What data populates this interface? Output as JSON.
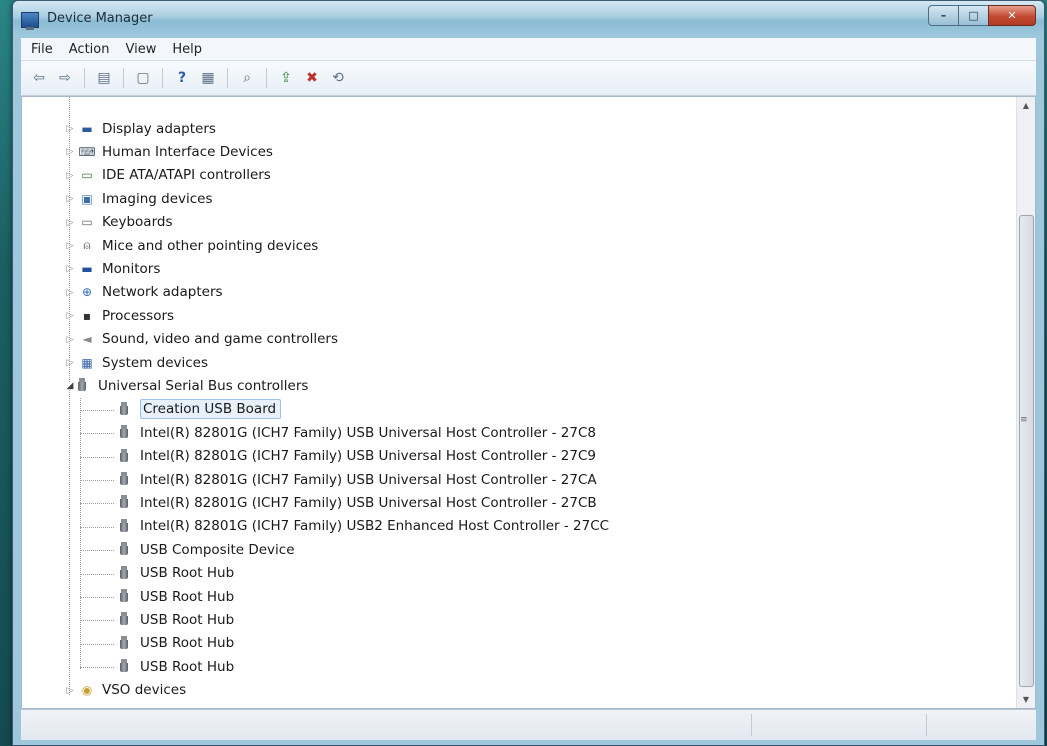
{
  "window": {
    "title": "Device Manager",
    "caption_buttons": {
      "minimize": "–",
      "maximize": "□",
      "close": "✕"
    }
  },
  "menu": [
    "File",
    "Action",
    "View",
    "Help"
  ],
  "toolbar": {
    "buttons": [
      "back-icon",
      "forward-icon",
      "console-tree-icon",
      "properties-icon",
      "help-icon",
      "show-hide-icon",
      "scan-changes-icon",
      "update-driver-icon",
      "uninstall-icon",
      "disable-icon"
    ]
  },
  "tree": {
    "categories_top": [
      {
        "label": "Display adapters",
        "icon": "display-adapter-icon"
      },
      {
        "label": "Human Interface Devices",
        "icon": "hid-icon"
      },
      {
        "label": "IDE ATA/ATAPI controllers",
        "icon": "ide-icon"
      },
      {
        "label": "Imaging devices",
        "icon": "imaging-icon"
      },
      {
        "label": "Keyboards",
        "icon": "keyboard-icon"
      },
      {
        "label": "Mice and other pointing devices",
        "icon": "mouse-icon"
      },
      {
        "label": "Monitors",
        "icon": "monitor-icon"
      },
      {
        "label": "Network adapters",
        "icon": "network-icon"
      },
      {
        "label": "Processors",
        "icon": "processor-icon"
      },
      {
        "label": "Sound, video and game controllers",
        "icon": "sound-icon"
      },
      {
        "label": "System devices",
        "icon": "system-icon"
      }
    ],
    "usb": {
      "label": "Universal Serial Bus controllers",
      "children": [
        "Creation  USB Board",
        "Intel(R) 82801G (ICH7 Family) USB Universal Host Controller - 27C8",
        "Intel(R) 82801G (ICH7 Family) USB Universal Host Controller - 27C9",
        "Intel(R) 82801G (ICH7 Family) USB Universal Host Controller - 27CA",
        "Intel(R) 82801G (ICH7 Family) USB Universal Host Controller - 27CB",
        "Intel(R) 82801G (ICH7 Family) USB2 Enhanced Host Controller - 27CC",
        "USB Composite Device",
        "USB Root Hub",
        "USB Root Hub",
        "USB Root Hub",
        "USB Root Hub",
        "USB Root Hub"
      ],
      "selected_index": 0
    },
    "categories_bottom": [
      {
        "label": "VSO devices",
        "icon": "vso-icon"
      }
    ]
  }
}
